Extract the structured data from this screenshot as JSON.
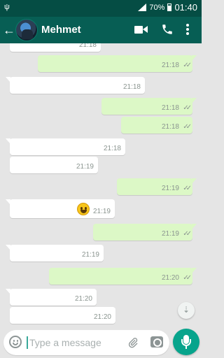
{
  "status_bar": {
    "usb_icon": "usb-icon",
    "battery": "70%",
    "time": "01:40"
  },
  "header": {
    "contact_name": "Mehmet",
    "back_icon": "back-arrow-icon",
    "video_icon": "video-call-icon",
    "call_icon": "phone-icon",
    "more_icon": "more-icon"
  },
  "messages": [
    {
      "dir": "out",
      "time": "21:18",
      "read": "✓✓"
    },
    {
      "dir": "in",
      "time": "21:18"
    },
    {
      "dir": "out",
      "time": "21:18",
      "read": "✓✓"
    },
    {
      "dir": "out",
      "time": "21:18",
      "read": "✓✓"
    },
    {
      "dir": "in",
      "time": "21:18"
    },
    {
      "dir": "in",
      "time": "21:19"
    },
    {
      "dir": "out",
      "time": "21:19",
      "read": "✓✓"
    },
    {
      "dir": "in",
      "time": "21:19",
      "emoji": "grinning-face"
    },
    {
      "dir": "out",
      "time": "21:19",
      "read": "✓✓"
    },
    {
      "dir": "in",
      "time": "21:19"
    },
    {
      "dir": "out",
      "time": "21:20",
      "read": "✓✓"
    },
    {
      "dir": "in",
      "time": "21:20"
    },
    {
      "dir": "in",
      "time": "21:20"
    }
  ],
  "partial_top_time": "21:18",
  "scroll_down_icon": "double-chevron-down-icon",
  "composer": {
    "placeholder": "Type a message",
    "emoji_icon": "emoji-icon",
    "attach_icon": "paperclip-icon",
    "camera_icon": "camera-icon",
    "mic_icon": "microphone-icon"
  },
  "colors": {
    "header": "#075e54",
    "status_bar": "#054d44",
    "outgoing": "#dcf8c6",
    "incoming": "#ffffff",
    "background": "#e5e5e5",
    "mic": "#07a48c"
  }
}
